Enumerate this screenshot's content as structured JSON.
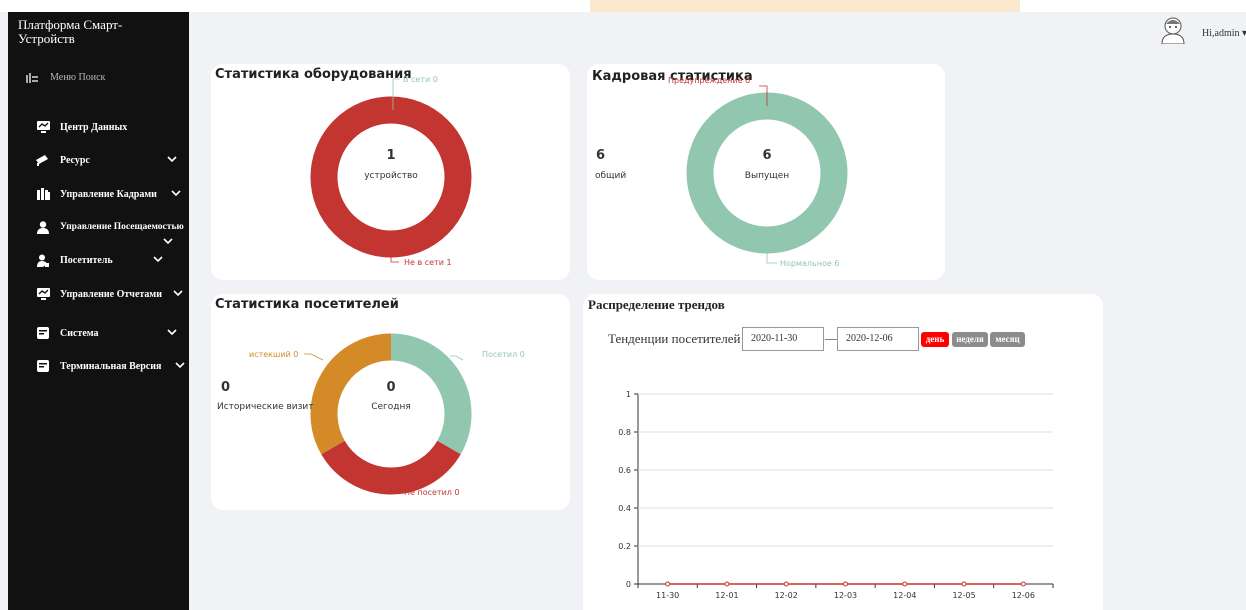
{
  "brand": {
    "title": "Платформа Смарт-Устройств"
  },
  "sidebar": {
    "search_label": "Меню Поиск",
    "items": [
      {
        "label": "Центр Данных",
        "icon": "dashboard-icon",
        "has_chevron": false
      },
      {
        "label": "Ресурс",
        "icon": "camera-icon",
        "has_chevron": true
      },
      {
        "label": "Управление Кадрами",
        "icon": "users-icon",
        "has_chevron": true
      },
      {
        "label": "Управление Посещаемостью",
        "icon": "person-icon",
        "has_chevron": true
      },
      {
        "label": "Посетитель",
        "icon": "visitor-icon",
        "has_chevron": true
      },
      {
        "label": "Управление Отчетами",
        "icon": "report-icon",
        "has_chevron": true
      },
      {
        "label": "Система",
        "icon": "system-icon",
        "has_chevron": true
      },
      {
        "label": "Терминальная Версия",
        "icon": "terminal-icon",
        "has_chevron": true
      }
    ]
  },
  "header": {
    "user_label": "Hi,admin"
  },
  "equipment": {
    "title": "Статистика оборудования",
    "center_value": "1",
    "center_label": "устройство",
    "online_label": "В сети 0",
    "offline_label": "Не в сети 1",
    "colors": {
      "offline": "#c23531",
      "online": "#91c7ae"
    }
  },
  "personnel": {
    "title": "Кадровая статистика",
    "total_value": "6",
    "total_label": "общий",
    "center_value": "6",
    "center_label": "Выпущен",
    "warning_label": "Предупреждение 0",
    "normal_label": "Нормальное 6",
    "colors": {
      "normal": "#91c7ae",
      "warning": "#c23531"
    }
  },
  "visitors": {
    "title": "Статистика посетителей",
    "history_value": "0",
    "history_label": "Исторические визит",
    "center_value": "0",
    "center_label": "Сегодня",
    "expired_label": "истекший 0",
    "visited_label": "Посетил 0",
    "not_visited_label": "Не посетил 0",
    "colors": {
      "expired": "#d48a26",
      "visited": "#91c7ae",
      "not_visited": "#c23531"
    }
  },
  "trends": {
    "title": "Распределение трендов",
    "label": "Тенденции посетителей",
    "date_from": "2020-11-30",
    "date_to": "2020-12-06",
    "dash": "—",
    "buttons": [
      {
        "label": "день",
        "active": true
      },
      {
        "label": "неделя",
        "active": false
      },
      {
        "label": "месяц",
        "active": false
      }
    ],
    "colors": {
      "active": "#ff0000",
      "inactive": "#8c8c8c",
      "line": "#c23531"
    }
  },
  "chart_data": {
    "type": "line",
    "x": [
      "11-30",
      "12-01",
      "12-02",
      "12-03",
      "12-04",
      "12-05",
      "12-06"
    ],
    "series": [
      {
        "values": [
          0,
          0,
          0,
          0,
          0,
          0,
          0
        ]
      }
    ],
    "yticks": [
      "0",
      "0.2",
      "0.4",
      "0.6",
      "0.8",
      "1"
    ],
    "ylim": [
      0,
      1
    ],
    "grid": true
  }
}
